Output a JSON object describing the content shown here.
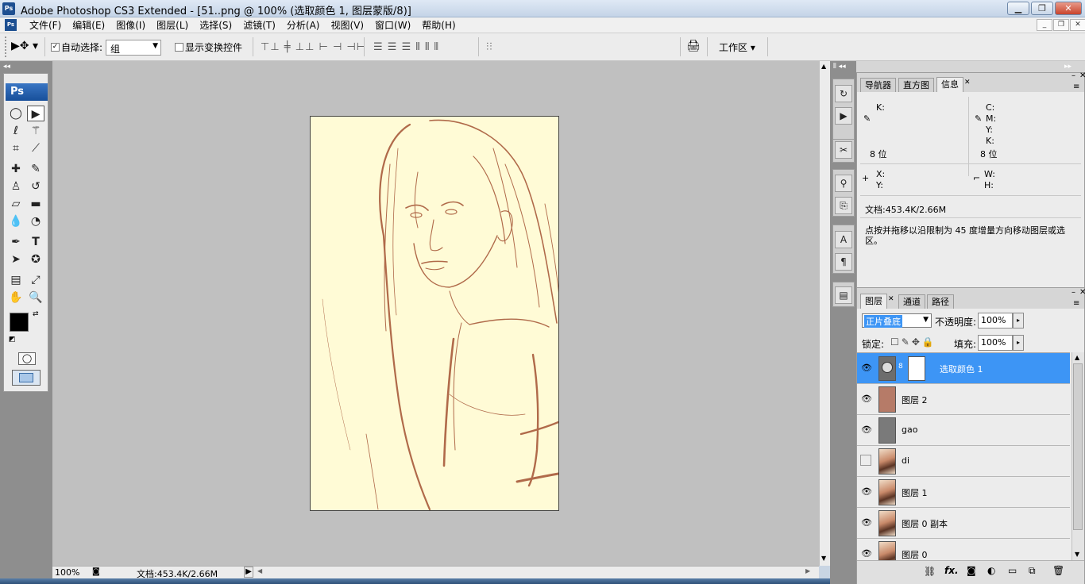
{
  "window": {
    "app_icon": "Ps",
    "title": "Adobe Photoshop CS3 Extended - [51..png @ 100% (选取颜色 1, 图层蒙版/8)]",
    "controls": [
      "minimize-icon",
      "restore-icon",
      "close-icon"
    ]
  },
  "menubar": {
    "items": [
      "文件(F)",
      "编辑(E)",
      "图像(I)",
      "图层(L)",
      "选择(S)",
      "滤镜(T)",
      "分析(A)",
      "视图(V)",
      "窗口(W)",
      "帮助(H)"
    ]
  },
  "options": {
    "auto_select_label": "自动选择:",
    "auto_select_checked": true,
    "auto_select_value": "组",
    "show_transform_label": "显示变换控件",
    "show_transform_checked": false,
    "workspace_label": "工作区 ▾"
  },
  "toolbox": {
    "logo": "Ps",
    "foreground_color": "#000000",
    "background_color": "#ffffff"
  },
  "canvas": {
    "bg_color": "#fffbd6",
    "line_color": "#b06a4a"
  },
  "statusbar": {
    "zoom": "100%",
    "doc_info": "文档:453.4K/2.66M"
  },
  "info_panel": {
    "tabs": [
      "导航器",
      "直方图",
      "信息"
    ],
    "active_tab": "信息",
    "k_label": "K:",
    "c_label": "C:",
    "m_label": "M:",
    "y_label": "Y:",
    "k2_label": "K:",
    "bit_left": "8 位",
    "bit_right": "8 位",
    "x_label": "X:",
    "y_coord_label": "Y:",
    "w_label": "W:",
    "h_label": "H:",
    "doc_info": "文档:453.4K/2.66M",
    "hint": "点按并拖移以沿限制为 45 度增量方向移动图层或选区。"
  },
  "layers_panel": {
    "tabs": [
      "图层",
      "通道",
      "路径"
    ],
    "active_tab": "图层",
    "blend_mode": "正片叠底",
    "opacity_label": "不透明度:",
    "opacity_value": "100%",
    "lock_label": "锁定:",
    "fill_label": "填充:",
    "fill_value": "100%",
    "layers": [
      {
        "name": "选取颜色 1",
        "visible": true,
        "selected": true,
        "thumb": "adjustment",
        "thumb_color": "#808080"
      },
      {
        "name": "图层 2",
        "visible": true,
        "selected": false,
        "thumb": "solid",
        "thumb_color": "#b67b68"
      },
      {
        "name": "gao",
        "visible": true,
        "selected": false,
        "thumb": "solid",
        "thumb_color": "#7a7a7a"
      },
      {
        "name": "di",
        "visible": false,
        "selected": false,
        "thumb": "photo",
        "thumb_color": "#c98a6a"
      },
      {
        "name": "图层 1",
        "visible": true,
        "selected": false,
        "thumb": "photo",
        "thumb_color": "#c98a6a"
      },
      {
        "name": "图层 0 副本",
        "visible": true,
        "selected": false,
        "thumb": "photo",
        "thumb_color": "#c98a6a"
      },
      {
        "name": "图层 0",
        "visible": true,
        "selected": false,
        "thumb": "photo",
        "thumb_color": "#c98a6a"
      }
    ],
    "footer_icons": [
      "link-icon",
      "fx-icon",
      "mask-icon",
      "adjustment-icon",
      "group-icon",
      "new-layer-icon",
      "trash-icon"
    ]
  },
  "colors": {
    "accent": "#3d95f5",
    "workspace_bg": "#c0c0c0",
    "panel_bg": "#ececec"
  }
}
